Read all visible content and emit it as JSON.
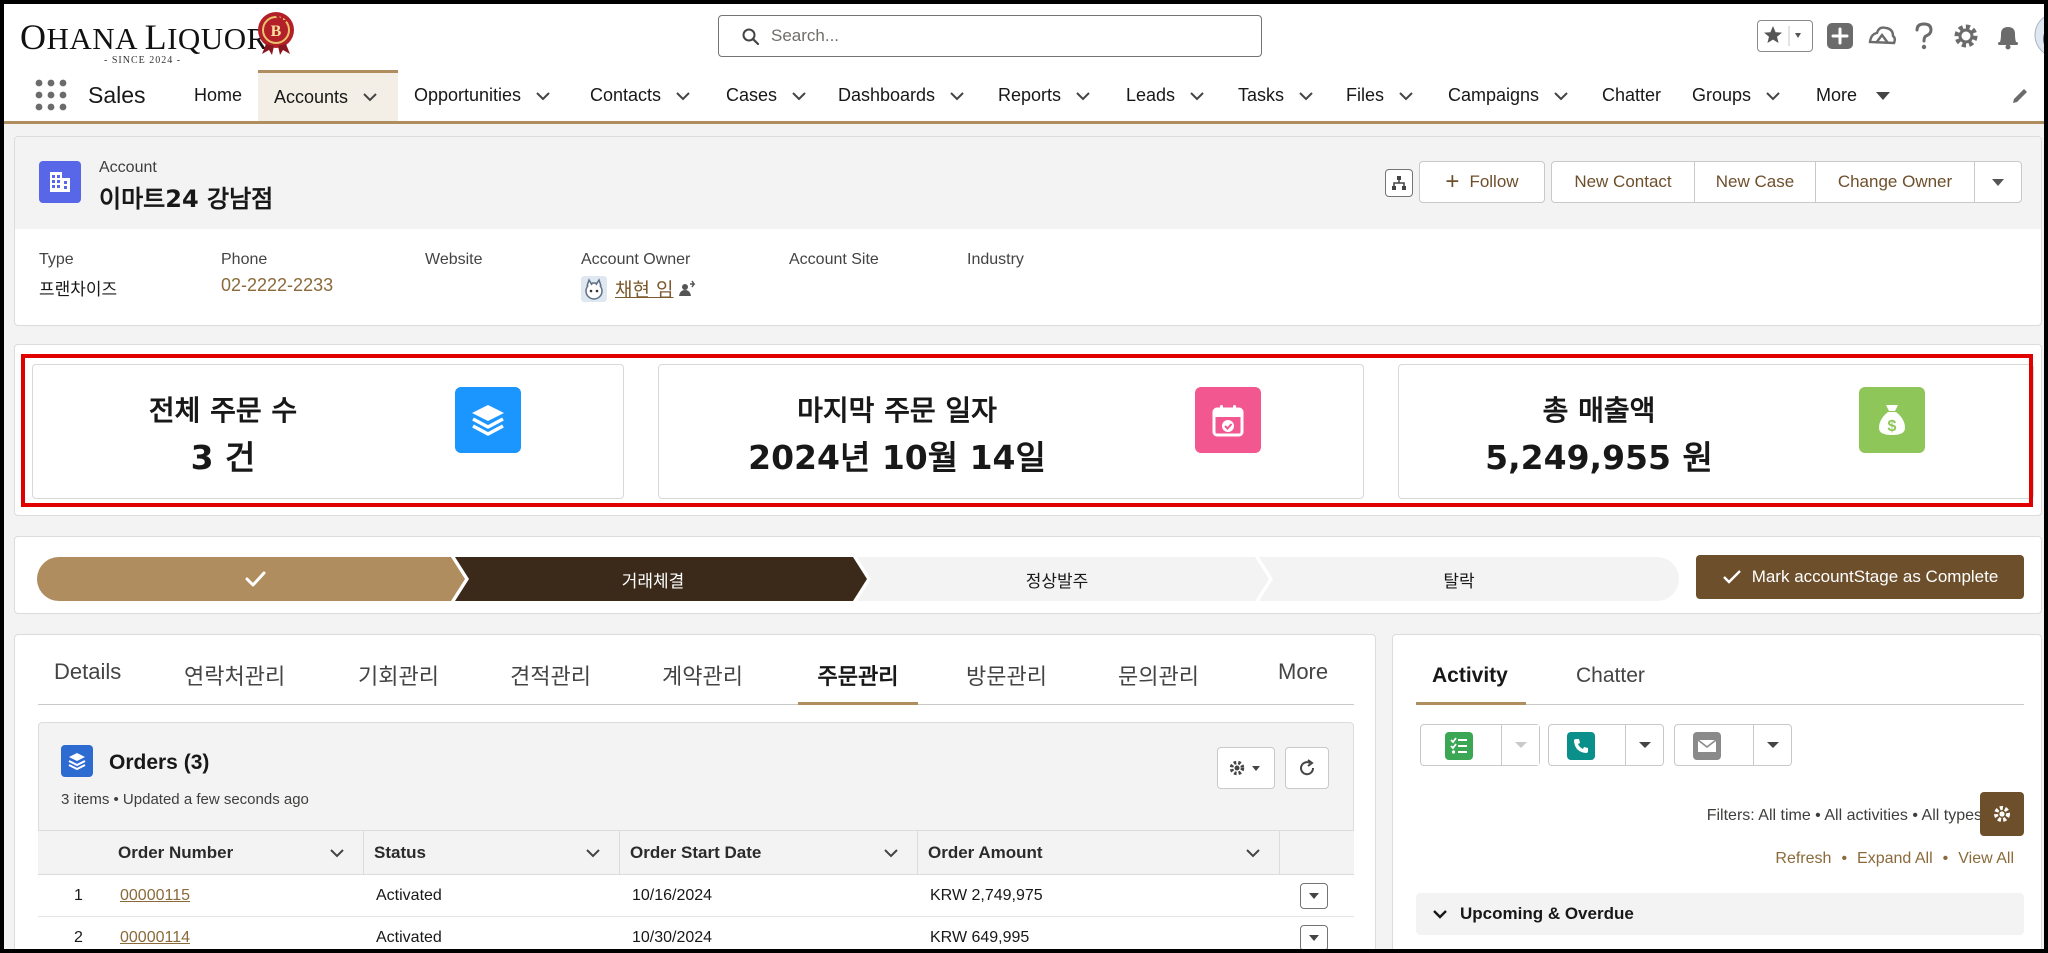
{
  "brand": {
    "name_first": "O",
    "name_rest_1": "HANA ",
    "name_second": "L",
    "name_rest_2": "IQUOR",
    "since": "- SINCE 2024 -"
  },
  "search": {
    "placeholder": "Search..."
  },
  "header_icons": [
    "favorites-star-icon",
    "add-icon",
    "trailhead-icon",
    "help-icon",
    "setup-gear-icon",
    "notifications-bell-icon",
    "user-avatar"
  ],
  "nav": {
    "app_name": "Sales",
    "items": [
      {
        "label": "Home",
        "dropdown": false
      },
      {
        "label": "Accounts",
        "dropdown": true,
        "active": true
      },
      {
        "label": "Opportunities",
        "dropdown": true
      },
      {
        "label": "Contacts",
        "dropdown": true
      },
      {
        "label": "Cases",
        "dropdown": true
      },
      {
        "label": "Dashboards",
        "dropdown": true
      },
      {
        "label": "Reports",
        "dropdown": true
      },
      {
        "label": "Leads",
        "dropdown": true
      },
      {
        "label": "Tasks",
        "dropdown": true
      },
      {
        "label": "Files",
        "dropdown": true
      },
      {
        "label": "Campaigns",
        "dropdown": true
      },
      {
        "label": "Chatter",
        "dropdown": false
      },
      {
        "label": "Groups",
        "dropdown": true
      },
      {
        "label": "More",
        "dropdown": true
      }
    ]
  },
  "record": {
    "object_label": "Account",
    "title": "이마트24 강남점",
    "actions": {
      "follow": "Follow",
      "new_contact": "New Contact",
      "new_case": "New Case",
      "change_owner": "Change Owner"
    },
    "fields": {
      "type": {
        "label": "Type",
        "value": "프랜차이즈"
      },
      "phone": {
        "label": "Phone",
        "value": "02-2222-2233"
      },
      "website": {
        "label": "Website",
        "value": ""
      },
      "owner": {
        "label": "Account Owner",
        "value": "채현 임"
      },
      "site": {
        "label": "Account Site",
        "value": ""
      },
      "industry": {
        "label": "Industry",
        "value": ""
      }
    }
  },
  "metrics": [
    {
      "title": "전체 주문 수",
      "value": "3 건",
      "icon": "stack-layers-icon",
      "color": "#1b96ff"
    },
    {
      "title": "마지막 주문 일자",
      "value": "2024년 10월 14일",
      "icon": "calendar-check-icon",
      "color": "#f2578f"
    },
    {
      "title": "총 매출액",
      "value": "5,249,955 원",
      "icon": "money-bag-icon",
      "color": "#8fc65a"
    }
  ],
  "path": {
    "stages": [
      {
        "label": "",
        "state": "complete"
      },
      {
        "label": "거래체결",
        "state": "current"
      },
      {
        "label": "정상발주",
        "state": "incomplete"
      },
      {
        "label": "탈락",
        "state": "incomplete"
      }
    ],
    "complete_button": "Mark accountStage as Complete",
    "colors": {
      "complete": "#b08d5e",
      "current": "#3b2a1a",
      "incomplete": "#f3f3f3"
    }
  },
  "tabs": [
    "Details",
    "연락처관리",
    "기회관리",
    "견적관리",
    "계약관리",
    "주문관리",
    "방문관리",
    "문의관리",
    "More"
  ],
  "active_tab": "주문관리",
  "orders": {
    "title": "Orders (3)",
    "meta": "3 items • Updated a few seconds ago",
    "columns": [
      "Order Number",
      "Status",
      "Order Start Date",
      "Order Amount"
    ],
    "rows": [
      {
        "n": "1",
        "number": "00000115",
        "status": "Activated",
        "start": "10/16/2024",
        "amount": "KRW 2,749,975"
      },
      {
        "n": "2",
        "number": "00000114",
        "status": "Activated",
        "start": "10/30/2024",
        "amount": "KRW 649,995"
      }
    ]
  },
  "activity": {
    "tabs": [
      "Activity",
      "Chatter"
    ],
    "filters": "Filters: All time • All activities • All types",
    "links": [
      "Refresh",
      "Expand All",
      "View All"
    ],
    "section": "Upcoming & Overdue"
  }
}
